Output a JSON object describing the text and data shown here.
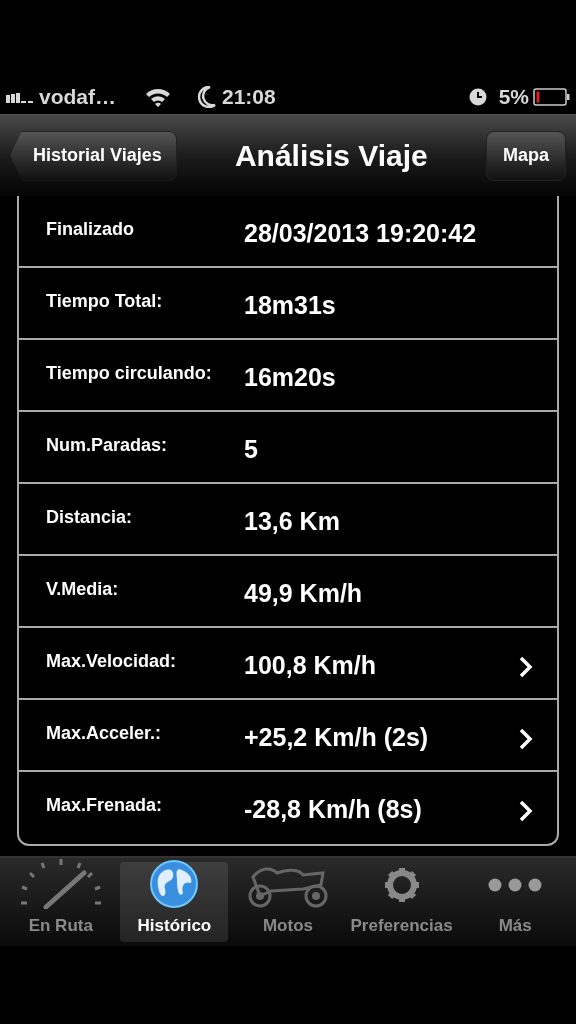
{
  "status_bar": {
    "carrier": "vodaf…",
    "time": "21:08",
    "battery": "5%"
  },
  "nav_bar": {
    "back_button": "Historial Viajes",
    "title": "Análisis Viaje",
    "right_button": "Mapa"
  },
  "rows": [
    {
      "label": "Finalizado",
      "value": "28/03/2013 19:20:42",
      "disclosure": false
    },
    {
      "label": "Tiempo Total:",
      "value": "18m31s",
      "disclosure": false
    },
    {
      "label": "Tiempo circulando:",
      "value": "16m20s",
      "disclosure": false
    },
    {
      "label": "Num.Paradas:",
      "value": "5",
      "disclosure": false
    },
    {
      "label": "Distancia:",
      "value": "13,6 Km",
      "disclosure": false
    },
    {
      "label": "V.Media:",
      "value": "49,9 Km/h",
      "disclosure": false
    },
    {
      "label": "Max.Velocidad:",
      "value": "100,8 Km/h",
      "disclosure": true
    },
    {
      "label": "Max.Acceler.:",
      "value": "+25,2 Km/h (2s)",
      "disclosure": true
    },
    {
      "label": "Max.Frenada:",
      "value": "-28,8 Km/h (8s)",
      "disclosure": true
    }
  ],
  "tab_bar": [
    {
      "label": "En Ruta",
      "kind": "gauge",
      "selected": false
    },
    {
      "label": "Histórico",
      "kind": "globe",
      "selected": true
    },
    {
      "label": "Motos",
      "kind": "motorbike",
      "selected": false
    },
    {
      "label": "Preferencias",
      "kind": "gear",
      "selected": false
    },
    {
      "label": "Más",
      "kind": "more",
      "selected": false
    }
  ]
}
